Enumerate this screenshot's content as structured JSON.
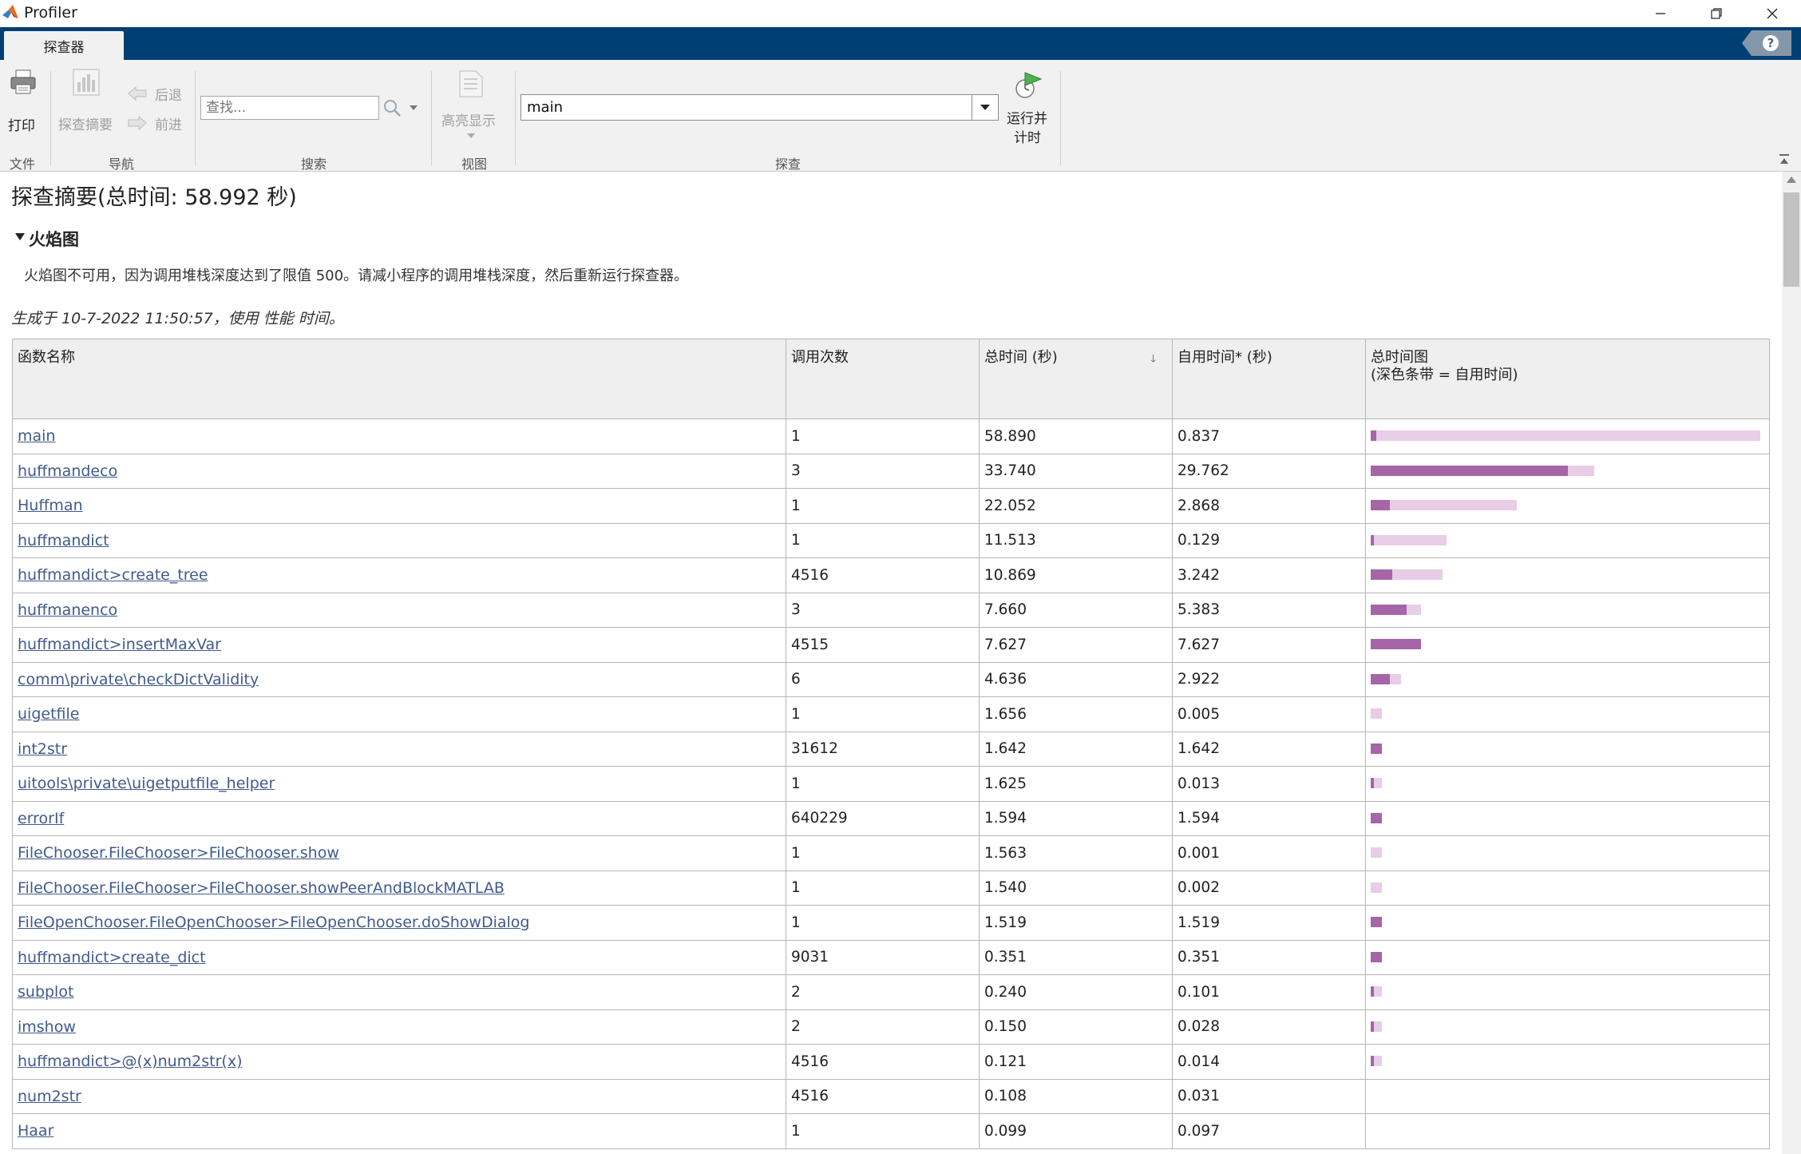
{
  "window": {
    "title": "Profiler"
  },
  "tabs": [
    {
      "label": "探查器"
    }
  ],
  "toolstrip": {
    "file": {
      "print_label": "打印",
      "group_label": "文件"
    },
    "nav": {
      "summary_label": "探查摘要",
      "back_label": "后退",
      "forward_label": "前进",
      "group_label": "导航"
    },
    "search": {
      "placeholder": "查找...",
      "group_label": "搜索"
    },
    "view": {
      "highlight_label": "高亮显示",
      "group_label": "视图"
    },
    "profile": {
      "combo_value": "main",
      "run_label_1": "运行并",
      "run_label_2": "计时",
      "group_label": "探查"
    }
  },
  "summary": {
    "title": "探查摘要(总时间: 58.992 秒)",
    "flame_heading": "火焰图",
    "flame_message": "火焰图不可用，因为调用堆栈深度达到了限值 500。请减小程序的调用堆栈深度，然后重新运行探查器。",
    "generated": "生成于 10-7-2022 11:50:57，使用 性能 时间。"
  },
  "table": {
    "headers": {
      "function": "函数名称",
      "calls": "调用次数",
      "total": "总时间 (秒)",
      "self": "自用时间* (秒)",
      "plot_line1": "总时间图",
      "plot_line2": "(深色条带 = 自用时间)"
    },
    "sorted_by": "total",
    "max_total": 58.89,
    "rows": [
      {
        "name": "main",
        "calls": "1",
        "total": "58.890",
        "self": "0.837"
      },
      {
        "name": "huffmandeco",
        "calls": "3",
        "total": "33.740",
        "self": "29.762"
      },
      {
        "name": "Huffman",
        "calls": "1",
        "total": "22.052",
        "self": "2.868"
      },
      {
        "name": "huffmandict",
        "calls": "1",
        "total": "11.513",
        "self": "0.129"
      },
      {
        "name": "huffmandict>create_tree",
        "calls": "4516",
        "total": "10.869",
        "self": "3.242"
      },
      {
        "name": "huffmanenco",
        "calls": "3",
        "total": "7.660",
        "self": "5.383"
      },
      {
        "name": "huffmandict>insertMaxVar",
        "calls": "4515",
        "total": "7.627",
        "self": "7.627"
      },
      {
        "name": "comm\\private\\checkDictValidity",
        "calls": "6",
        "total": "4.636",
        "self": "2.922"
      },
      {
        "name": "uigetfile",
        "calls": "1",
        "total": "1.656",
        "self": "0.005"
      },
      {
        "name": "int2str",
        "calls": "31612",
        "total": "1.642",
        "self": "1.642"
      },
      {
        "name": "uitools\\private\\uigetputfile_helper",
        "calls": "1",
        "total": "1.625",
        "self": "0.013"
      },
      {
        "name": "errorIf",
        "calls": "640229",
        "total": "1.594",
        "self": "1.594"
      },
      {
        "name": "FileChooser.FileChooser>FileChooser.show",
        "calls": "1",
        "total": "1.563",
        "self": "0.001"
      },
      {
        "name": "FileChooser.FileChooser>FileChooser.showPeerAndBlockMATLAB",
        "calls": "1",
        "total": "1.540",
        "self": "0.002"
      },
      {
        "name": "FileOpenChooser.FileOpenChooser>FileOpenChooser.doShowDialog",
        "calls": "1",
        "total": "1.519",
        "self": "1.519"
      },
      {
        "name": "huffmandict>create_dict",
        "calls": "9031",
        "total": "0.351",
        "self": "0.351"
      },
      {
        "name": "subplot",
        "calls": "2",
        "total": "0.240",
        "self": "0.101"
      },
      {
        "name": "imshow",
        "calls": "2",
        "total": "0.150",
        "self": "0.028"
      },
      {
        "name": "huffmandict>@(x)num2str(x)",
        "calls": "4516",
        "total": "0.121",
        "self": "0.014"
      },
      {
        "name": "num2str",
        "calls": "4516",
        "total": "0.108",
        "self": "0.031"
      },
      {
        "name": "Haar",
        "calls": "1",
        "total": "0.099",
        "self": "0.097"
      }
    ]
  },
  "colors": {
    "tabbar": "#003f74",
    "bar_total": "#e7cde6",
    "bar_self": "#a565a7",
    "link": "#405a8c"
  },
  "icons": [
    "matlab-logo",
    "minimize-icon",
    "restore-icon",
    "close-icon",
    "help-icon",
    "printer-icon",
    "summary-icon",
    "back-arrow-icon",
    "forward-arrow-icon",
    "search-icon",
    "dropdown-icon",
    "highlight-icon",
    "run-timer-icon",
    "collapse-toolstrip-icon",
    "expand-triangle-icon",
    "sort-arrow-icon"
  ]
}
